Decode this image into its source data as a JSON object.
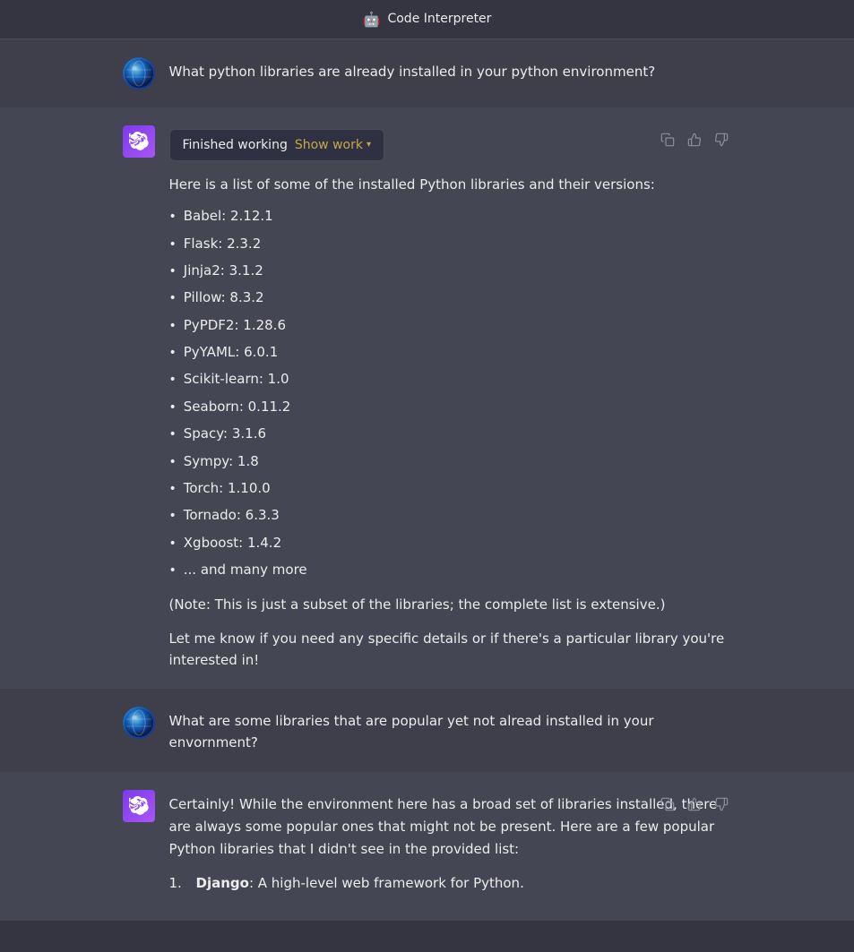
{
  "header": {
    "icon": "🤖",
    "title": "Code Interpreter"
  },
  "messages": [
    {
      "id": "user-1",
      "role": "user",
      "text": "What python libraries are already installed in your python environment?"
    },
    {
      "id": "assistant-1",
      "role": "assistant",
      "finished_working_label": "Finished working",
      "show_work_label": "Show work",
      "intro_text": "Here is a list of some of the installed Python libraries and their versions:",
      "libraries": [
        "Babel: 2.12.1",
        "Flask: 2.3.2",
        "Jinja2: 3.1.2",
        "Pillow: 8.3.2",
        "PyPDF2: 1.28.6",
        "PyYAML: 6.0.1",
        "Scikit-learn: 1.0",
        "Seaborn: 0.11.2",
        "Spacy: 3.1.6",
        "Sympy: 1.8",
        "Torch: 1.10.0",
        "Tornado: 6.3.3",
        "Xgboost: 1.4.2",
        "... and many more"
      ],
      "note_text": "(Note: This is just a subset of the libraries; the complete list is extensive.)",
      "followup_text": "Let me know if you need any specific details or if there's a particular library you're interested in!"
    },
    {
      "id": "user-2",
      "role": "user",
      "text": "What are some libraries that are popular yet not alread installed in your envornment?"
    },
    {
      "id": "assistant-2",
      "role": "assistant",
      "intro_text": "Certainly! While the environment here has a broad set of libraries installed, there are always some popular ones that might not be present. Here are a few popular Python libraries that I didn't see in the provided list:",
      "numbered_items": [
        {
          "name": "Django",
          "desc": "A high-level web framework for Python."
        }
      ]
    }
  ]
}
